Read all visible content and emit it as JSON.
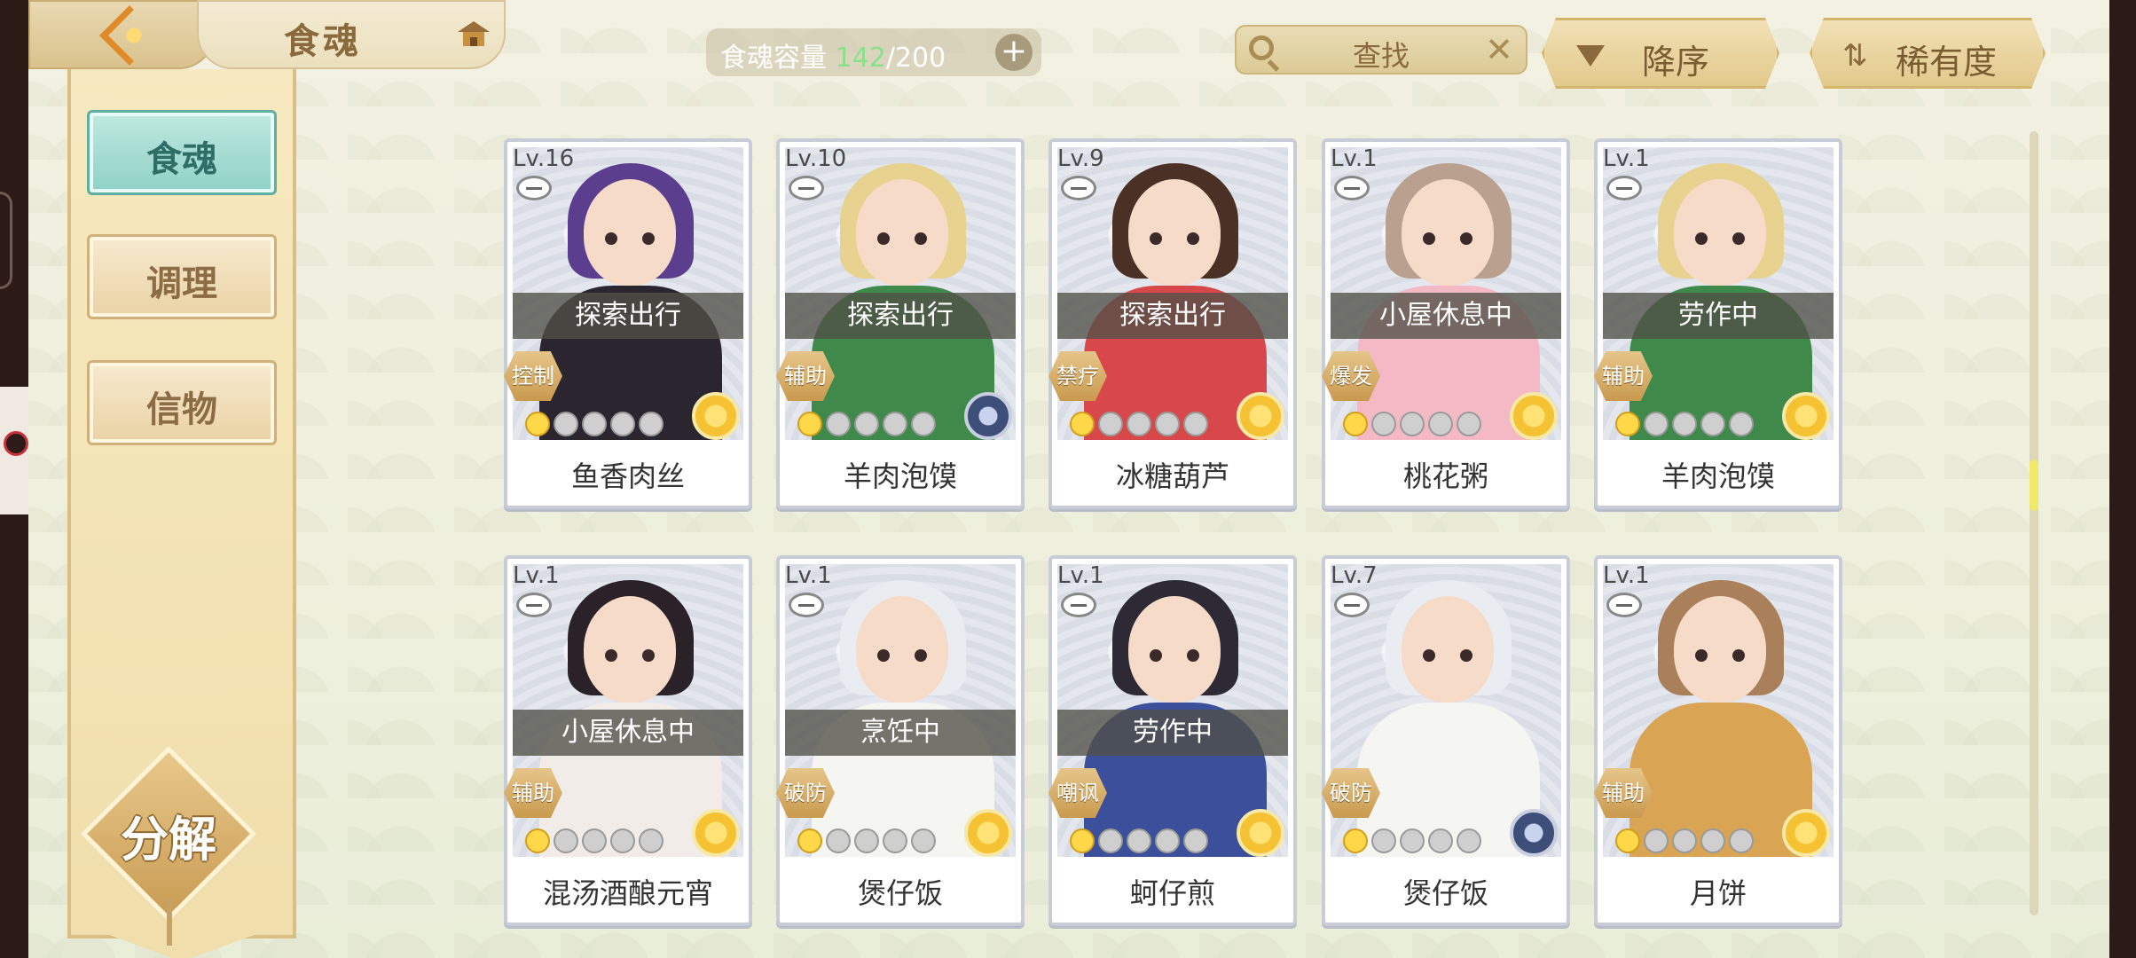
{
  "header": {
    "title": "食魂",
    "capacity_label": "食魂容量",
    "capacity_current": "142",
    "capacity_total": "/200",
    "search_label": "查找",
    "sort_order_label": "降序",
    "sort_key_label": "稀有度"
  },
  "sidebar": {
    "tabs": [
      {
        "label": "食魂",
        "active": true
      },
      {
        "label": "调理",
        "active": false
      },
      {
        "label": "信物",
        "active": false
      }
    ],
    "decompose_label": "分解"
  },
  "cards": [
    {
      "level": "Lv.16",
      "status": "探索出行",
      "role": "控制",
      "stars": 1,
      "badge": "gold",
      "name": "鱼香肉丝",
      "hair": "#5b3f8e",
      "outfit": "#2b2530"
    },
    {
      "level": "Lv.10",
      "status": "探索出行",
      "role": "辅助",
      "stars": 1,
      "badge": "blue",
      "name": "羊肉泡馍",
      "hair": "#e8d28f",
      "outfit": "#3f8a4a"
    },
    {
      "level": "Lv.9",
      "status": "探索出行",
      "role": "禁疗",
      "stars": 1,
      "badge": "gold",
      "name": "冰糖葫芦",
      "hair": "#4a3025",
      "outfit": "#d8484a"
    },
    {
      "level": "Lv.1",
      "status": "小屋休息中",
      "role": "爆发",
      "stars": 1,
      "badge": "gold",
      "name": "桃花粥",
      "hair": "#b9a08f",
      "outfit": "#f3b9c4"
    },
    {
      "level": "Lv.1",
      "status": "劳作中",
      "role": "辅助",
      "stars": 1,
      "badge": "gold",
      "name": "羊肉泡馍",
      "hair": "#e8d28f",
      "outfit": "#3f8a4a"
    },
    {
      "level": "Lv.1",
      "status": "小屋休息中",
      "role": "辅助",
      "stars": 1,
      "badge": "gold",
      "name": "混汤酒酿元宵",
      "hair": "#2a2228",
      "outfit": "#f2ece8"
    },
    {
      "level": "Lv.1",
      "status": "烹饪中",
      "role": "破防",
      "stars": 1,
      "badge": "gold",
      "name": "煲仔饭",
      "hair": "#e9ecf1",
      "outfit": "#f5f5f2"
    },
    {
      "level": "Lv.1",
      "status": "劳作中",
      "role": "嘲讽",
      "stars": 1,
      "badge": "gold",
      "name": "蚵仔煎",
      "hair": "#2d2a35",
      "outfit": "#3b4f9a"
    },
    {
      "level": "Lv.7",
      "status": "",
      "role": "破防",
      "stars": 1,
      "badge": "blue",
      "name": "煲仔饭",
      "hair": "#e9ecf1",
      "outfit": "#f5f5f2"
    },
    {
      "level": "Lv.1",
      "status": "",
      "role": "辅助",
      "stars": 1,
      "badge": "gold",
      "name": "月饼",
      "hair": "#a9805a",
      "outfit": "#d9a453"
    }
  ]
}
